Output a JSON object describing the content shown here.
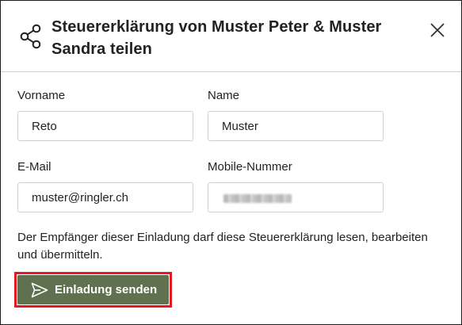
{
  "dialog": {
    "title": "Steuererklärung von Muster Peter & Muster Sandra teilen",
    "share_icon": "share-icon",
    "close_icon": "close-icon"
  },
  "form": {
    "first_name": {
      "label": "Vorname",
      "value": "Reto"
    },
    "last_name": {
      "label": "Name",
      "value": "Muster"
    },
    "email": {
      "label": "E-Mail",
      "value": "muster@ringler.ch"
    },
    "mobile": {
      "label": "Mobile-Nummer",
      "value": ""
    }
  },
  "description": "Der Empfänger dieser Einladung darf diese Steuererklärung lesen, bearbeiten und übermitteln.",
  "actions": {
    "send_label": "Einladung senden",
    "send_icon": "paper-plane-icon"
  },
  "colors": {
    "button_bg": "#60714f",
    "focus_ring": "#e3191f",
    "border": "#1c1c1c"
  }
}
